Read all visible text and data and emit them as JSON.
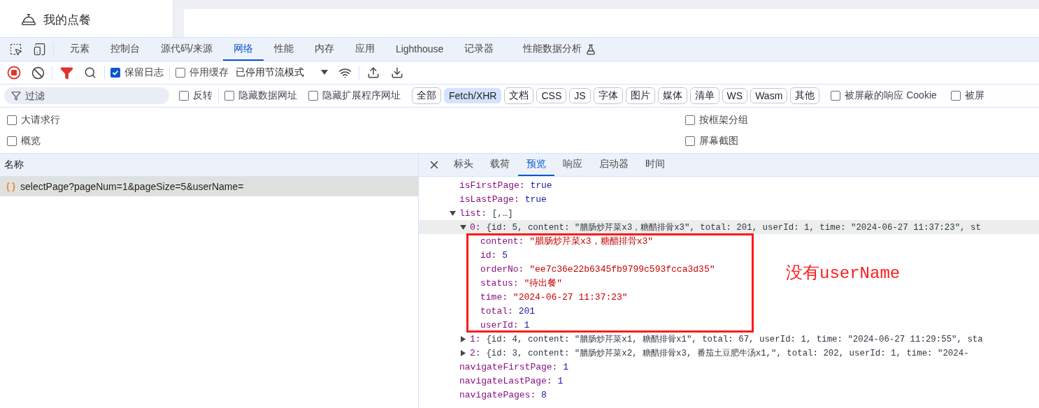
{
  "app": {
    "nav_item": "我的点餐"
  },
  "devtools": {
    "panel_tabs": [
      {
        "label": "元素",
        "selected": false
      },
      {
        "label": "控制台",
        "selected": false
      },
      {
        "label": "源代码/来源",
        "selected": false
      },
      {
        "label": "网络",
        "selected": true
      },
      {
        "label": "性能",
        "selected": false
      },
      {
        "label": "内存",
        "selected": false
      },
      {
        "label": "应用",
        "selected": false
      },
      {
        "label": "Lighthouse",
        "selected": false
      },
      {
        "label": "记录器",
        "selected": false
      },
      {
        "label": "性能数据分析",
        "selected": false
      }
    ],
    "toolbar": {
      "filter_active": true,
      "preserve_log": {
        "label": "保留日志",
        "checked": true
      },
      "disable_cache": {
        "label": "停用缓存",
        "checked": false
      },
      "throttling": "已停用节流模式"
    },
    "filter_bar": {
      "placeholder": "过滤",
      "options_before": [
        {
          "label": "反转",
          "checked": false
        },
        {
          "label": "隐藏数据网址",
          "checked": false
        },
        {
          "label": "隐藏扩展程序网址",
          "checked": false
        }
      ],
      "types": [
        {
          "label": "全部",
          "selected": false
        },
        {
          "label": "Fetch/XHR",
          "selected": true
        },
        {
          "label": "文档",
          "selected": false
        },
        {
          "label": "CSS",
          "selected": false
        },
        {
          "label": "JS",
          "selected": false
        },
        {
          "label": "字体",
          "selected": false
        },
        {
          "label": "图片",
          "selected": false
        },
        {
          "label": "媒体",
          "selected": false
        },
        {
          "label": "清单",
          "selected": false
        },
        {
          "label": "WS",
          "selected": false
        },
        {
          "label": "Wasm",
          "selected": false
        },
        {
          "label": "其他",
          "selected": false
        }
      ],
      "options_after": [
        {
          "label": "被屏蔽的响应 Cookie",
          "checked": false
        },
        {
          "label": "被屏",
          "checked": false
        }
      ]
    },
    "options_left": [
      {
        "label": "大请求行",
        "checked": false
      },
      {
        "label": "概览",
        "checked": false
      }
    ],
    "options_right": [
      {
        "label": "按框架分组",
        "checked": false
      },
      {
        "label": "屏幕截图",
        "checked": false
      }
    ],
    "requests": {
      "column": "名称",
      "rows": [
        {
          "name": "selectPage?pageNum=1&pageSize=5&userName=",
          "selected": true
        }
      ]
    },
    "detail_tabs": [
      {
        "label": "标头",
        "selected": false
      },
      {
        "label": "载荷",
        "selected": false
      },
      {
        "label": "预览",
        "selected": true
      },
      {
        "label": "响应",
        "selected": false
      },
      {
        "label": "启动器",
        "selected": false
      },
      {
        "label": "时间",
        "selected": false
      }
    ],
    "preview": [
      {
        "key": "isFirstPage:",
        "value": "true",
        "kind": "literal"
      },
      {
        "key": "isLastPage:",
        "value": "true",
        "kind": "literal"
      },
      {
        "key": "list:",
        "value": "[,…]",
        "kind": "summary",
        "expanded": true,
        "children": [
          {
            "key": "0:",
            "value": "{id: 5, content: \"腊肠炒芹菜x3，糖醋排骨x3\", total: 201, userId: 1, time: \"2024-06-27 11:37:23\", st",
            "kind": "summary",
            "expanded": true,
            "selected": true,
            "children": [
              {
                "key": "content:",
                "value": "\"腊肠炒芹菜x3，糖醋排骨x3\"",
                "kind": "string"
              },
              {
                "key": "id:",
                "value": "5",
                "kind": "literal"
              },
              {
                "key": "orderNo:",
                "value": "\"ee7c36e22b6345fb9799c593fcca3d35\"",
                "kind": "string"
              },
              {
                "key": "status:",
                "value": "\"待出餐\"",
                "kind": "string"
              },
              {
                "key": "time:",
                "value": "\"2024-06-27 11:37:23\"",
                "kind": "string"
              },
              {
                "key": "total:",
                "value": "201",
                "kind": "literal"
              },
              {
                "key": "userId:",
                "value": "1",
                "kind": "literal"
              }
            ]
          },
          {
            "key": "1:",
            "value": "{id: 4, content: \"腊肠炒芹菜x1, 糖醋排骨x1\", total: 67, userId: 1, time: \"2024-06-27 11:29:55\", sta",
            "kind": "summary",
            "expanded": false,
            "selected": false
          },
          {
            "key": "2:",
            "value": "{id: 3, content: \"腊肠炒芹菜x2, 糖醋排骨x3, 番茄土豆肥牛汤x1,\", total: 202, userId: 1, time: \"2024-",
            "kind": "summary",
            "expanded": false,
            "selected": false
          }
        ]
      },
      {
        "key": "navigateFirstPage:",
        "value": "1",
        "kind": "literal"
      },
      {
        "key": "navigateLastPage:",
        "value": "1",
        "kind": "literal"
      },
      {
        "key": "navigatePages:",
        "value": "8",
        "kind": "literal"
      }
    ],
    "annotation": "没有userName"
  }
}
